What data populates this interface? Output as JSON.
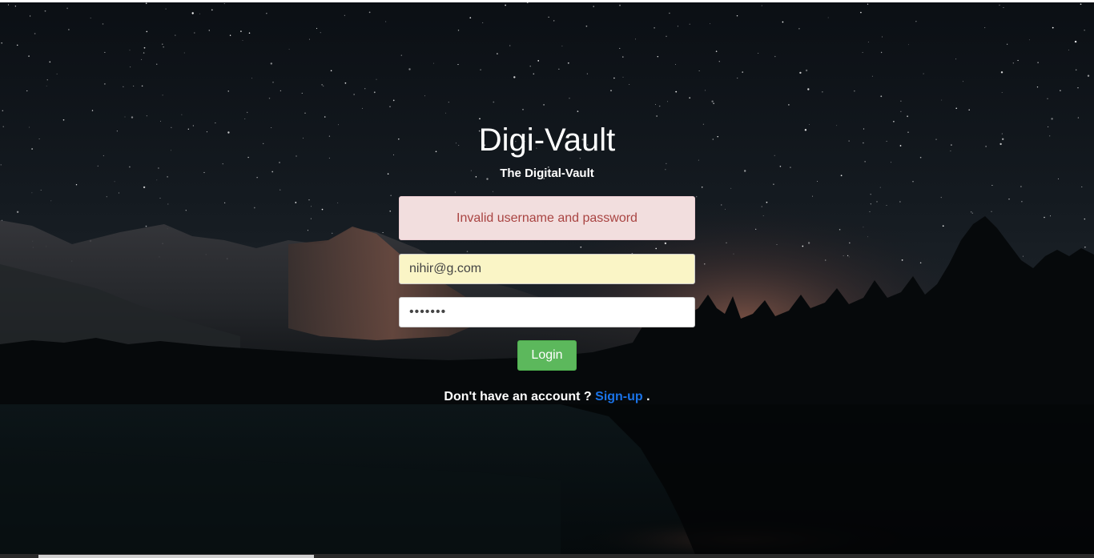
{
  "app": {
    "title": "Digi-Vault",
    "subtitle": "The Digital-Vault"
  },
  "alert": {
    "message": "Invalid username and password"
  },
  "form": {
    "email_value": "nihir@g.com",
    "password_value": "•••••••",
    "login_label": "Login"
  },
  "signup": {
    "prompt": "Don't have an account ?",
    "link_label": "Sign-up",
    "suffix": "."
  },
  "colors": {
    "alert_bg": "#f2dede",
    "alert_text": "#a94442",
    "login_bg": "#5cb85c",
    "link": "#1a73e8",
    "autofill_bg": "#faf5c6"
  }
}
